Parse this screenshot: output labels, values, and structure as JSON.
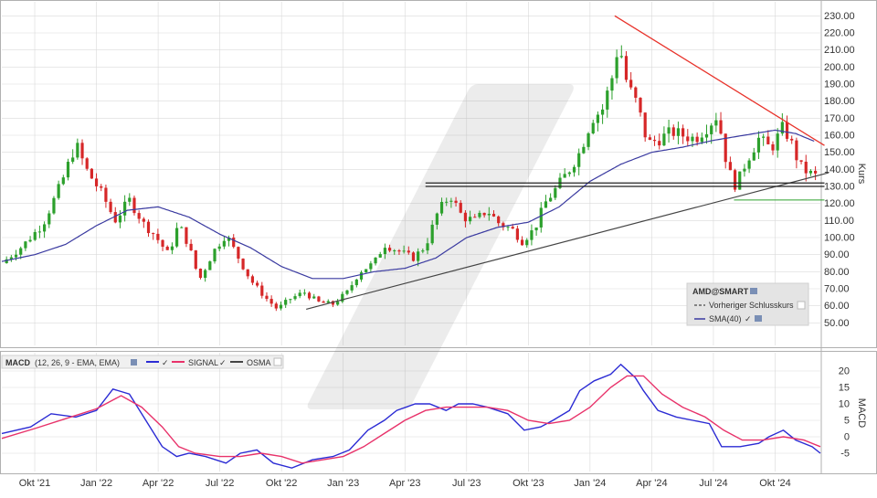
{
  "colors": {
    "up": "#2ca02c",
    "down": "#d62728",
    "sma": "#3a3aa0",
    "macd": "#2b2bd4",
    "signal": "#e8326a",
    "trend_down": "#e8322a",
    "trend_up": "#444444",
    "support": "#222222",
    "grid": "#d9d9d9",
    "support_low": "#2ca02c"
  },
  "price_panel": {
    "legend": {
      "ticker": "AMD@SMART",
      "prev_close_label": "Vorheriger Schlusskurs",
      "sma_label": "SMA(40)"
    },
    "axis_label": "Kurs"
  },
  "macd_panel": {
    "header": {
      "label": "MACD",
      "params": "(12, 26, 9 - EMA, EMA)",
      "signal": "SIGNAL",
      "osma": "OSMA"
    },
    "axis_label": "MACD"
  },
  "chart_data": [
    {
      "type": "candlestick",
      "title": "AMD@SMART",
      "ylabel": "Kurs",
      "ylim": [
        40,
        235
      ],
      "y_ticks": [
        50,
        60,
        70,
        80,
        90,
        100,
        110,
        120,
        130,
        140,
        150,
        160,
        170,
        180,
        190,
        200,
        210,
        220,
        230
      ],
      "x_tick_labels": [
        "Okt '21",
        "Jan '22",
        "Apr '22",
        "Jul '22",
        "Okt '22",
        "Jan '23",
        "Apr '23",
        "Jul '23",
        "Okt '23",
        "Jan '24",
        "Apr '24",
        "Jul '24",
        "Okt '24"
      ],
      "x_tick_months": [
        0,
        3,
        6,
        9,
        12,
        15,
        18,
        21,
        24,
        27,
        30,
        33,
        36
      ],
      "x_range_months": [
        -1.6,
        38.2
      ],
      "price_anchors": [
        [
          -1.6,
          85
        ],
        [
          -0.6,
          95
        ],
        [
          0.4,
          108
        ],
        [
          1.3,
          132
        ],
        [
          2.0,
          155
        ],
        [
          2.5,
          140
        ],
        [
          3.3,
          125
        ],
        [
          3.9,
          110
        ],
        [
          4.6,
          122
        ],
        [
          5.3,
          108
        ],
        [
          5.8,
          102
        ],
        [
          6.5,
          90
        ],
        [
          7.0,
          108
        ],
        [
          7.5,
          95
        ],
        [
          8.0,
          75
        ],
        [
          8.7,
          92
        ],
        [
          9.3,
          102
        ],
        [
          10.0,
          86
        ],
        [
          10.5,
          75
        ],
        [
          11.2,
          65
        ],
        [
          11.8,
          58
        ],
        [
          12.4,
          64
        ],
        [
          13.1,
          68
        ],
        [
          13.8,
          62
        ],
        [
          14.5,
          61
        ],
        [
          15.2,
          68
        ],
        [
          15.8,
          80
        ],
        [
          16.5,
          85
        ],
        [
          17.0,
          96
        ],
        [
          17.7,
          92
        ],
        [
          18.4,
          88
        ],
        [
          19.0,
          95
        ],
        [
          19.6,
          115
        ],
        [
          20.2,
          125
        ],
        [
          20.8,
          112
        ],
        [
          21.4,
          110
        ],
        [
          22.0,
          116
        ],
        [
          22.6,
          108
        ],
        [
          23.2,
          105
        ],
        [
          23.7,
          98
        ],
        [
          24.3,
          105
        ],
        [
          24.8,
          120
        ],
        [
          25.3,
          128
        ],
        [
          26.0,
          140
        ],
        [
          26.5,
          150
        ],
        [
          27.1,
          170
        ],
        [
          27.6,
          175
        ],
        [
          28.1,
          195
        ],
        [
          28.4,
          215
        ],
        [
          28.8,
          190
        ],
        [
          29.3,
          178
        ],
        [
          29.8,
          155
        ],
        [
          30.4,
          158
        ],
        [
          31.0,
          162
        ],
        [
          31.5,
          160
        ],
        [
          32.1,
          158
        ],
        [
          32.7,
          165
        ],
        [
          33.2,
          172
        ],
        [
          33.7,
          140
        ],
        [
          34.1,
          130
        ],
        [
          34.6,
          145
        ],
        [
          35.2,
          158
        ],
        [
          35.8,
          152
        ],
        [
          36.4,
          165
        ],
        [
          36.8,
          155
        ],
        [
          37.2,
          142
        ],
        [
          37.6,
          138
        ],
        [
          38.0,
          136
        ],
        [
          38.2,
          128
        ]
      ],
      "sma_anchors": [
        [
          -1.6,
          86
        ],
        [
          0.0,
          90
        ],
        [
          1.5,
          96
        ],
        [
          3.0,
          107
        ],
        [
          4.5,
          116
        ],
        [
          6.0,
          118
        ],
        [
          7.5,
          112
        ],
        [
          9.0,
          102
        ],
        [
          10.5,
          94
        ],
        [
          12.0,
          83
        ],
        [
          13.5,
          76
        ],
        [
          15.0,
          76
        ],
        [
          16.5,
          80
        ],
        [
          18.0,
          82
        ],
        [
          19.5,
          88
        ],
        [
          21.0,
          100
        ],
        [
          22.5,
          106
        ],
        [
          24.0,
          109
        ],
        [
          25.5,
          118
        ],
        [
          27.0,
          133
        ],
        [
          28.5,
          143
        ],
        [
          30.0,
          150
        ],
        [
          31.5,
          153
        ],
        [
          33.0,
          157
        ],
        [
          34.5,
          160
        ],
        [
          36.0,
          163
        ],
        [
          37.0,
          161
        ],
        [
          38.0,
          156
        ]
      ],
      "trendlines": [
        {
          "name": "downtrend-resistance",
          "from": [
            28.2,
            230
          ],
          "to": [
            38.4,
            154
          ]
        },
        {
          "name": "uptrend-support",
          "from": [
            13.2,
            58
          ],
          "to": [
            38.6,
            138
          ]
        },
        {
          "name": "horizontal-support-upper",
          "from": [
            19.0,
            132
          ],
          "to": [
            38.4,
            132
          ]
        },
        {
          "name": "horizontal-support-lower",
          "from": [
            19.0,
            130
          ],
          "to": [
            38.4,
            130
          ]
        },
        {
          "name": "support-low",
          "from": [
            34.0,
            122
          ],
          "to": [
            38.4,
            122
          ]
        }
      ],
      "legend": [
        "Vorheriger Schlusskurs",
        "SMA(40)"
      ],
      "legend_position": "bottom-right",
      "grid": true
    },
    {
      "type": "line",
      "title": "MACD (12, 26, 9 - EMA, EMA)",
      "ylabel": "MACD",
      "ylim": [
        -10,
        25
      ],
      "y_ticks": [
        -5,
        0,
        5,
        10,
        15,
        20
      ],
      "series": [
        {
          "name": "MACD",
          "points": [
            [
              -1.6,
              1
            ],
            [
              -0.2,
              3
            ],
            [
              0.8,
              7
            ],
            [
              2.0,
              6
            ],
            [
              3.0,
              8
            ],
            [
              3.8,
              14.5
            ],
            [
              4.6,
              13
            ],
            [
              5.4,
              5
            ],
            [
              6.2,
              -3
            ],
            [
              6.9,
              -6
            ],
            [
              7.5,
              -5
            ],
            [
              8.3,
              -6
            ],
            [
              9.3,
              -8
            ],
            [
              10.0,
              -5
            ],
            [
              10.8,
              -4
            ],
            [
              11.6,
              -8
            ],
            [
              12.5,
              -9.5
            ],
            [
              13.5,
              -7
            ],
            [
              14.5,
              -6
            ],
            [
              15.3,
              -4
            ],
            [
              16.2,
              2
            ],
            [
              17.0,
              5
            ],
            [
              17.6,
              8
            ],
            [
              18.5,
              10
            ],
            [
              19.2,
              10
            ],
            [
              20.0,
              8
            ],
            [
              20.6,
              10
            ],
            [
              21.3,
              10
            ],
            [
              22.0,
              9
            ],
            [
              23.0,
              7
            ],
            [
              23.8,
              2
            ],
            [
              24.6,
              3
            ],
            [
              25.2,
              5
            ],
            [
              26.0,
              8
            ],
            [
              26.5,
              14
            ],
            [
              27.2,
              17
            ],
            [
              28.0,
              19
            ],
            [
              28.5,
              22
            ],
            [
              29.2,
              18
            ],
            [
              29.6,
              14
            ],
            [
              30.3,
              8
            ],
            [
              31.2,
              6
            ],
            [
              32.0,
              5
            ],
            [
              32.8,
              4
            ],
            [
              33.4,
              -3
            ],
            [
              34.3,
              -3
            ],
            [
              35.2,
              -2
            ],
            [
              35.7,
              0
            ],
            [
              36.4,
              2
            ],
            [
              37.0,
              -1
            ],
            [
              37.8,
              -3
            ],
            [
              38.2,
              -5
            ]
          ]
        },
        {
          "name": "SIGNAL",
          "points": [
            [
              -1.6,
              -0.5
            ],
            [
              0.0,
              2.5
            ],
            [
              1.5,
              5.5
            ],
            [
              3.0,
              8.5
            ],
            [
              4.2,
              12.5
            ],
            [
              5.2,
              9
            ],
            [
              6.2,
              3
            ],
            [
              7.0,
              -3
            ],
            [
              7.8,
              -5
            ],
            [
              9.0,
              -6
            ],
            [
              10.0,
              -6
            ],
            [
              11.0,
              -5
            ],
            [
              12.0,
              -6
            ],
            [
              13.0,
              -8
            ],
            [
              14.0,
              -7
            ],
            [
              15.0,
              -6
            ],
            [
              16.0,
              -3
            ],
            [
              17.0,
              1
            ],
            [
              18.0,
              5
            ],
            [
              19.0,
              8
            ],
            [
              20.0,
              9
            ],
            [
              21.0,
              9
            ],
            [
              22.0,
              9
            ],
            [
              23.0,
              8
            ],
            [
              24.0,
              5
            ],
            [
              25.0,
              4
            ],
            [
              26.0,
              5
            ],
            [
              27.0,
              9
            ],
            [
              28.0,
              15
            ],
            [
              28.8,
              18.5
            ],
            [
              29.6,
              18.5
            ],
            [
              30.5,
              13
            ],
            [
              31.5,
              9
            ],
            [
              32.6,
              6
            ],
            [
              33.5,
              2
            ],
            [
              34.4,
              -1
            ],
            [
              35.4,
              -1
            ],
            [
              36.4,
              0
            ],
            [
              37.4,
              -1
            ],
            [
              38.2,
              -3
            ]
          ]
        },
        {
          "name": "OSMA",
          "points": []
        }
      ],
      "legend_position": "top-left",
      "grid": true
    }
  ]
}
